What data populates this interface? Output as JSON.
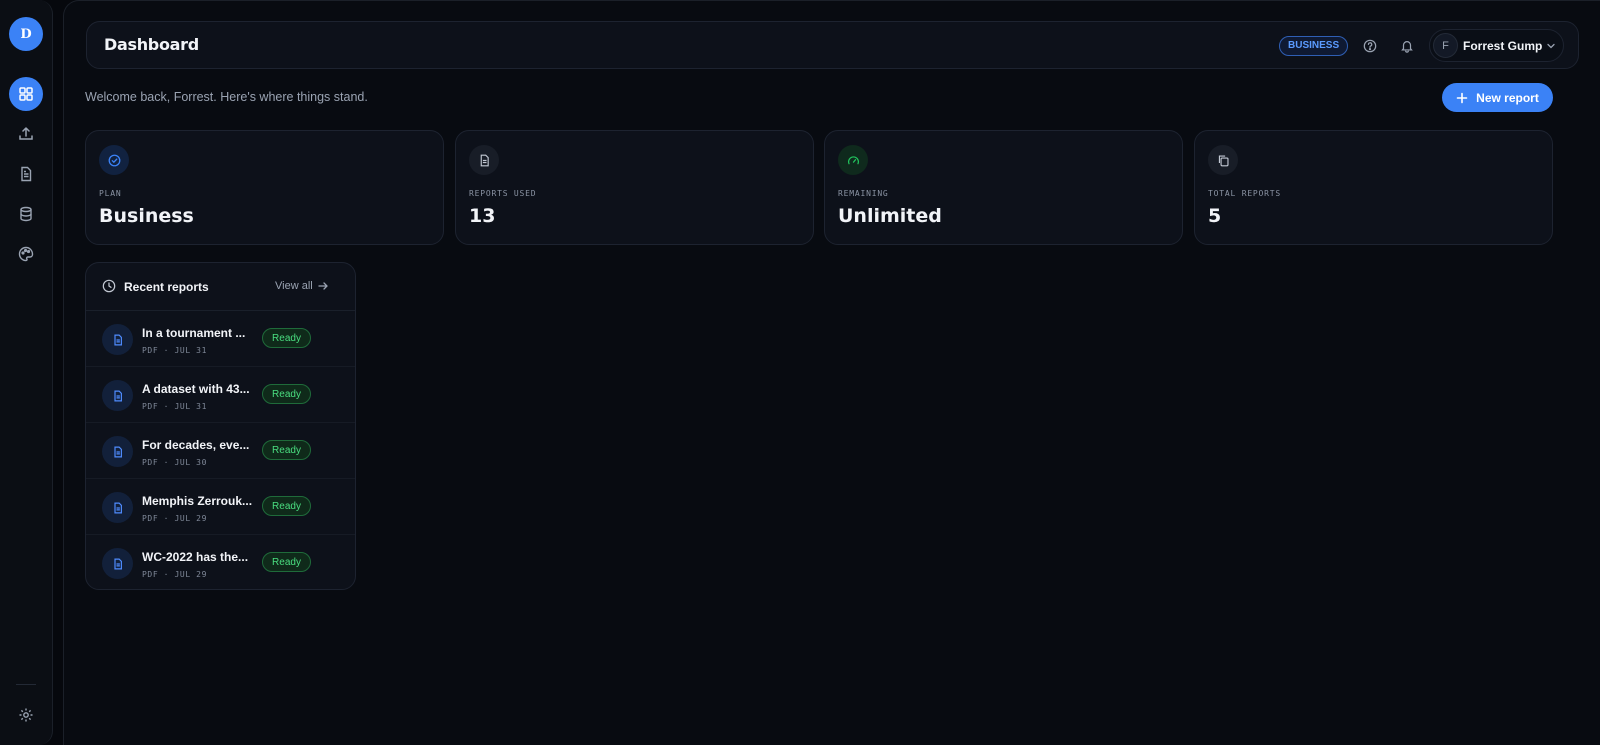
{
  "sidebar": {
    "brand_initial": "D",
    "items": [
      {
        "icon": "grid-icon",
        "active": true
      },
      {
        "icon": "upload-icon",
        "active": false
      },
      {
        "icon": "document-icon",
        "active": false
      },
      {
        "icon": "database-icon",
        "active": false
      },
      {
        "icon": "palette-icon",
        "active": false
      }
    ],
    "footer_icon": "gear-icon"
  },
  "header": {
    "title": "Dashboard",
    "plan_badge": "BUSINESS",
    "icons": [
      "help-icon",
      "bell-icon"
    ],
    "user": {
      "initial": "F",
      "name": "Forrest Gump"
    }
  },
  "welcome": "Welcome back, Forrest. Here's where things stand.",
  "new_report_label": "New report",
  "stats": [
    {
      "label": "PLAN",
      "value": "Business",
      "icon": "check-circle-icon",
      "accent": "#3b82f6"
    },
    {
      "label": "REPORTS USED",
      "value": "13",
      "icon": "document-icon",
      "accent": "#c3c9d4"
    },
    {
      "label": "REMAINING",
      "value": "Unlimited",
      "icon": "gauge-icon",
      "accent": "#22c55e"
    },
    {
      "label": "TOTAL REPORTS",
      "value": "5",
      "icon": "copy-icon",
      "accent": "#c3c9d4"
    }
  ],
  "recent": {
    "title": "Recent reports",
    "view_all": "View all",
    "items": [
      {
        "title": "In a tournament ...",
        "type": "PDF",
        "date": "JUL 31",
        "status": "Ready"
      },
      {
        "title": "A dataset with 43...",
        "type": "PDF",
        "date": "JUL 31",
        "status": "Ready"
      },
      {
        "title": "For decades, eve...",
        "type": "PDF",
        "date": "JUL 30",
        "status": "Ready"
      },
      {
        "title": "Memphis Zerrouk...",
        "type": "PDF",
        "date": "JUL 29",
        "status": "Ready"
      },
      {
        "title": "WC-2022 has the...",
        "type": "PDF",
        "date": "JUL 29",
        "status": "Ready"
      }
    ]
  },
  "colors": {
    "accent": "#3b82f6",
    "ready": "#4ade80",
    "background": "#06080d"
  }
}
